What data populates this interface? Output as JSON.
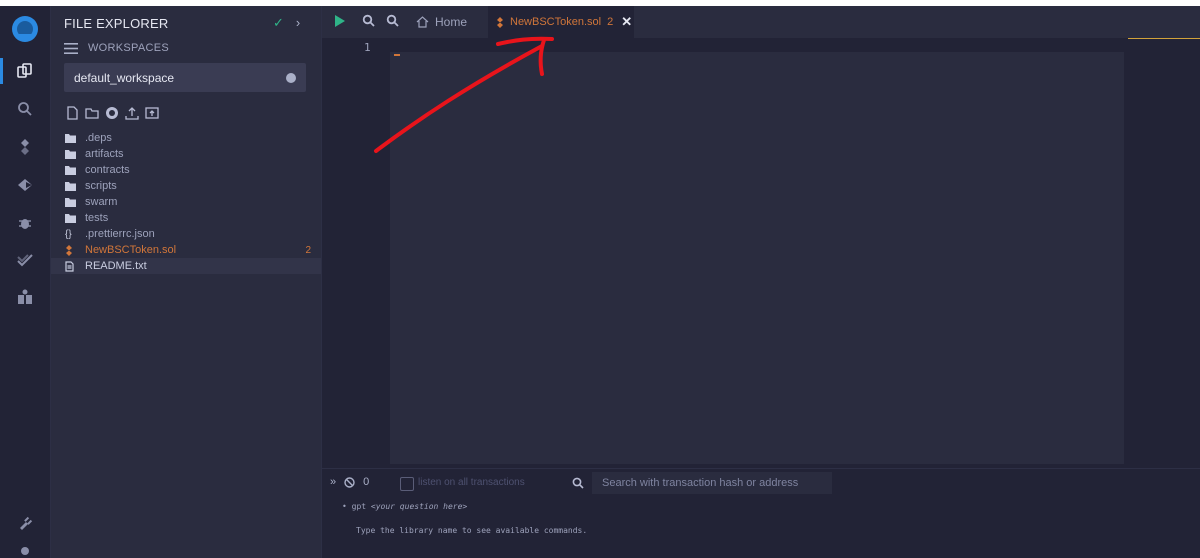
{
  "sidebar": {
    "title": "FILE EXPLORER",
    "workspaces_label": "WORKSPACES",
    "workspace_selected": "default_workspace",
    "tree": [
      {
        "label": ".deps",
        "type": "folder"
      },
      {
        "label": "artifacts",
        "type": "folder"
      },
      {
        "label": "contracts",
        "type": "folder"
      },
      {
        "label": "scripts",
        "type": "folder"
      },
      {
        "label": "swarm",
        "type": "folder"
      },
      {
        "label": "tests",
        "type": "folder"
      },
      {
        "label": ".prettierrc.json",
        "type": "json"
      },
      {
        "label": "NewBSCToken.sol",
        "type": "sol",
        "badge": "2"
      },
      {
        "label": "README.txt",
        "type": "txt"
      }
    ]
  },
  "editor": {
    "home_tab": "Home",
    "active_tab": {
      "label": "NewBSCToken.sol",
      "badge": "2"
    },
    "line_number": "1"
  },
  "terminal": {
    "count": "0",
    "listen_label": "listen on all transactions",
    "search_placeholder": "Search with transaction hash or address",
    "line1_prefix": "• gpt ",
    "line1_hint": "<your question here>",
    "line2": "Type the library name to see available commands."
  },
  "colors": {
    "background": "#222336",
    "panel": "#2a2c3f",
    "accent_orange": "#d1763a",
    "accent_green": "#2fb488",
    "annotation_red": "#e8141b"
  }
}
